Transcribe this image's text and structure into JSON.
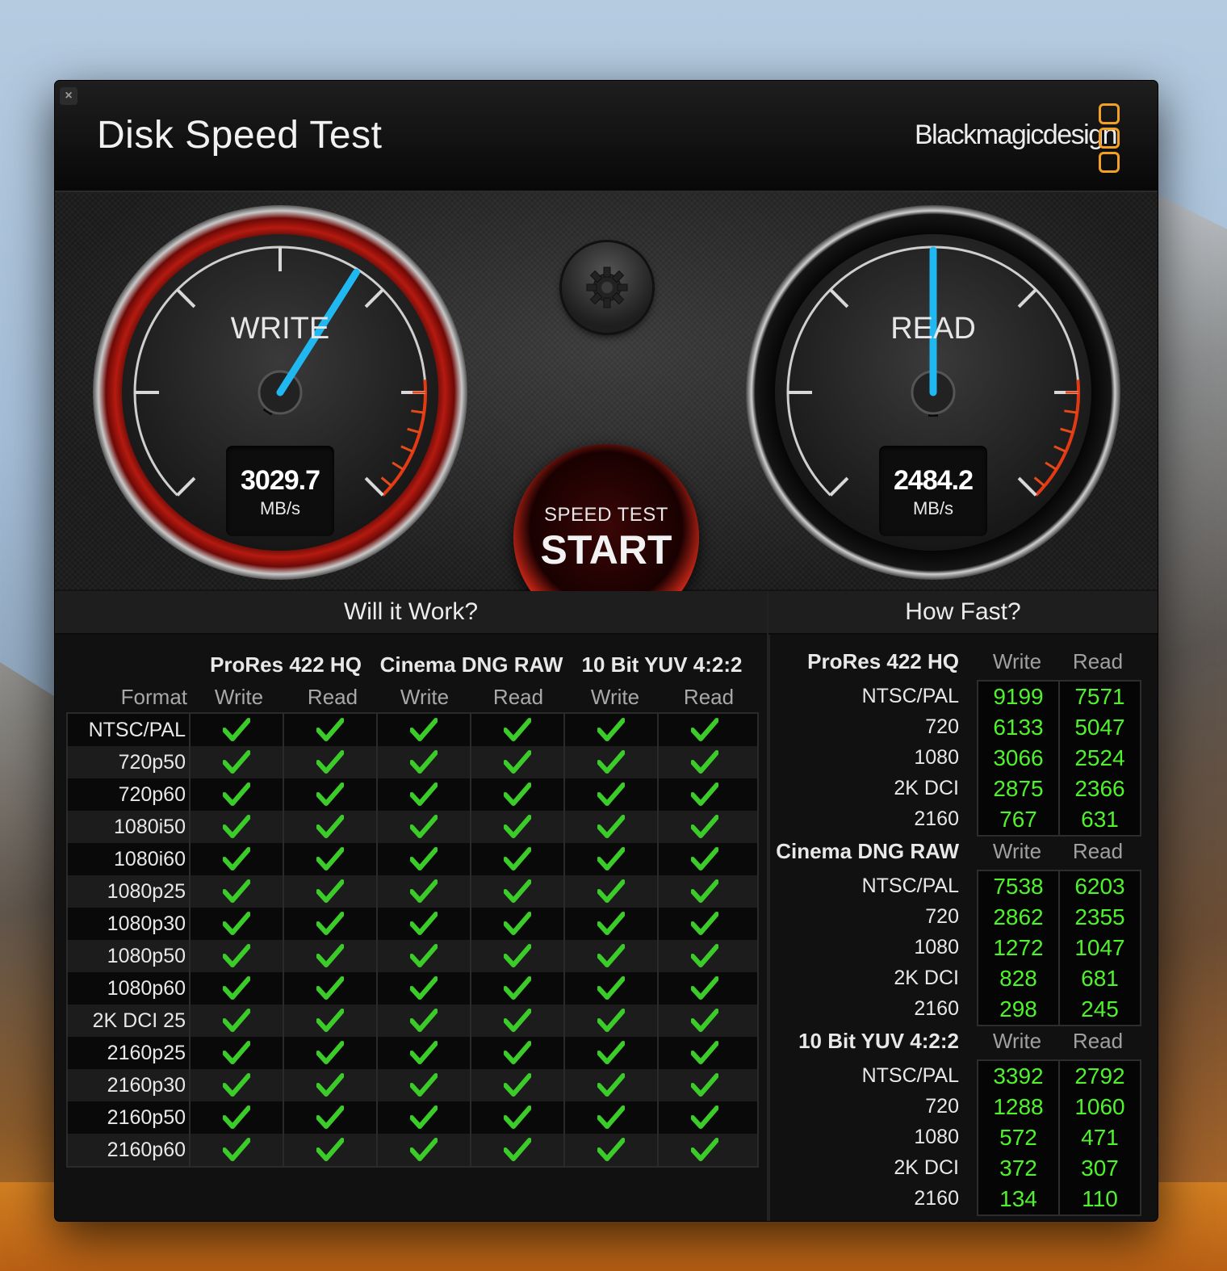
{
  "window": {
    "title": "Disk Speed Test",
    "brand": "Blackmagicdesign",
    "close_label": "×"
  },
  "gauges": {
    "write": {
      "label": "WRITE",
      "value": "3029.7",
      "unit": "MB/s",
      "needle_fraction": 0.62
    },
    "read": {
      "label": "READ",
      "value": "2484.2",
      "unit": "MB/s",
      "needle_fraction": 0.5
    }
  },
  "start_button": {
    "small": "SPEED TEST",
    "big": "START"
  },
  "settings_button": {
    "icon": "gear-icon"
  },
  "colors": {
    "check": "#3ccc2a",
    "value_green": "#4ff22c",
    "accent_red": "#d02818",
    "needle_blue": "#20b8f0",
    "logo_orange": "#f4a024"
  },
  "will_it_work": {
    "title": "Will it Work?",
    "format_label": "Format",
    "codecs": [
      "ProRes 422 HQ",
      "Cinema DNG RAW",
      "10 Bit YUV 4:2:2"
    ],
    "subcols": [
      "Write",
      "Read",
      "Write",
      "Read",
      "Write",
      "Read"
    ],
    "rows": [
      {
        "format": "NTSC/PAL",
        "checks": [
          true,
          true,
          true,
          true,
          true,
          true
        ]
      },
      {
        "format": "720p50",
        "checks": [
          true,
          true,
          true,
          true,
          true,
          true
        ]
      },
      {
        "format": "720p60",
        "checks": [
          true,
          true,
          true,
          true,
          true,
          true
        ]
      },
      {
        "format": "1080i50",
        "checks": [
          true,
          true,
          true,
          true,
          true,
          true
        ]
      },
      {
        "format": "1080i60",
        "checks": [
          true,
          true,
          true,
          true,
          true,
          true
        ]
      },
      {
        "format": "1080p25",
        "checks": [
          true,
          true,
          true,
          true,
          true,
          true
        ]
      },
      {
        "format": "1080p30",
        "checks": [
          true,
          true,
          true,
          true,
          true,
          true
        ]
      },
      {
        "format": "1080p50",
        "checks": [
          true,
          true,
          true,
          true,
          true,
          true
        ]
      },
      {
        "format": "1080p60",
        "checks": [
          true,
          true,
          true,
          true,
          true,
          true
        ]
      },
      {
        "format": "2K DCI 25",
        "checks": [
          true,
          true,
          true,
          true,
          true,
          true
        ]
      },
      {
        "format": "2160p25",
        "checks": [
          true,
          true,
          true,
          true,
          true,
          true
        ]
      },
      {
        "format": "2160p30",
        "checks": [
          true,
          true,
          true,
          true,
          true,
          true
        ]
      },
      {
        "format": "2160p50",
        "checks": [
          true,
          true,
          true,
          true,
          true,
          true
        ]
      },
      {
        "format": "2160p60",
        "checks": [
          true,
          true,
          true,
          true,
          true,
          true
        ]
      }
    ]
  },
  "how_fast": {
    "title": "How Fast?",
    "write_label": "Write",
    "read_label": "Read",
    "groups": [
      {
        "name": "ProRes 422 HQ",
        "rows": [
          {
            "res": "NTSC/PAL",
            "write": "9199",
            "read": "7571"
          },
          {
            "res": "720",
            "write": "6133",
            "read": "5047"
          },
          {
            "res": "1080",
            "write": "3066",
            "read": "2524"
          },
          {
            "res": "2K DCI",
            "write": "2875",
            "read": "2366"
          },
          {
            "res": "2160",
            "write": "767",
            "read": "631"
          }
        ]
      },
      {
        "name": "Cinema DNG RAW",
        "rows": [
          {
            "res": "NTSC/PAL",
            "write": "7538",
            "read": "6203"
          },
          {
            "res": "720",
            "write": "2862",
            "read": "2355"
          },
          {
            "res": "1080",
            "write": "1272",
            "read": "1047"
          },
          {
            "res": "2K DCI",
            "write": "828",
            "read": "681"
          },
          {
            "res": "2160",
            "write": "298",
            "read": "245"
          }
        ]
      },
      {
        "name": "10 Bit YUV 4:2:2",
        "rows": [
          {
            "res": "NTSC/PAL",
            "write": "3392",
            "read": "2792"
          },
          {
            "res": "720",
            "write": "1288",
            "read": "1060"
          },
          {
            "res": "1080",
            "write": "572",
            "read": "471"
          },
          {
            "res": "2K DCI",
            "write": "372",
            "read": "307"
          },
          {
            "res": "2160",
            "write": "134",
            "read": "110"
          }
        ]
      }
    ]
  }
}
